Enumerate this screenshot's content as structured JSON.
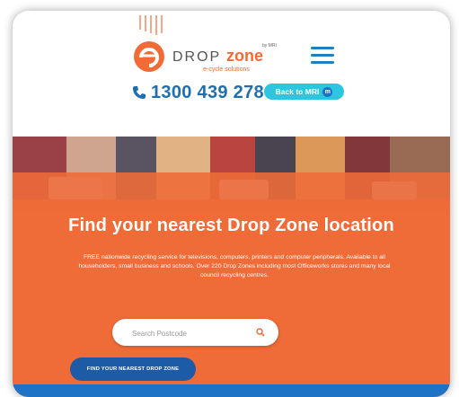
{
  "header": {
    "logo": {
      "word1": "DROP",
      "word2": "zone",
      "tagline": "e-cycle solutions",
      "byline": "by MRI"
    },
    "phone": "1300 439 278",
    "back_button": "Back to MRI",
    "back_button_badge": "m"
  },
  "hero": {
    "title": "Find your nearest Drop Zone location",
    "description": "FREE nationwide recycling service for televisions, computers, printers and computer peripherals. Available to all householders, small business and schools. Over 220 Drop Zones including most Officeworks stores and many local council recycling centres."
  },
  "search": {
    "placeholder": "Search Postcode",
    "value": ""
  },
  "cta": {
    "label": "FIND YOUR NEAREST DROP ZONE"
  },
  "colors": {
    "orange": "#f26b35",
    "blue": "#1e6fb0",
    "cyan": "#2ec5e0",
    "dark_blue": "#1d5ba7",
    "zone_orange": "#f26b35"
  },
  "icons": [
    "menu-icon",
    "phone-icon",
    "mri-badge-icon",
    "search-icon"
  ]
}
